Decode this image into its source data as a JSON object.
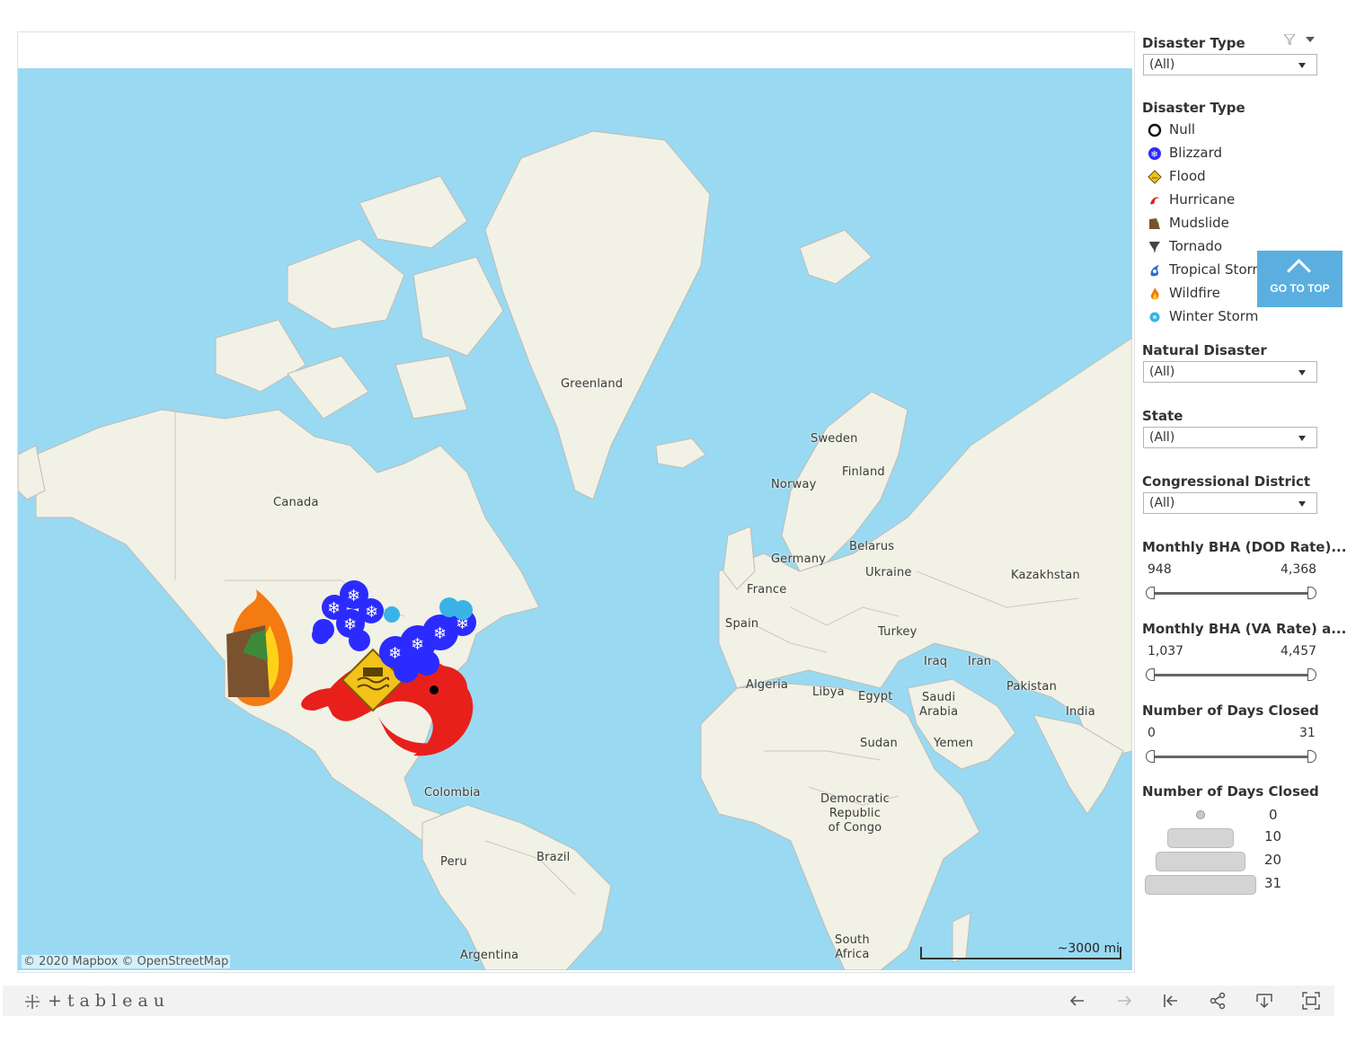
{
  "map": {
    "attribution": "© 2020 Mapbox © OpenStreetMap",
    "scale_label": "~3000 mi",
    "colors": {
      "water": "#9ad9f2",
      "land": "#f1f1e6",
      "border": "#bdbdb4"
    },
    "places": [
      {
        "name": "Greenland"
      },
      {
        "name": "Canada"
      },
      {
        "name": "Sweden"
      },
      {
        "name": "Finland"
      },
      {
        "name": "Norway"
      },
      {
        "name": "Belarus"
      },
      {
        "name": "Germany"
      },
      {
        "name": "Ukraine"
      },
      {
        "name": "Kazakhstan"
      },
      {
        "name": "France"
      },
      {
        "name": "Spain"
      },
      {
        "name": "Turkey"
      },
      {
        "name": "Iraq"
      },
      {
        "name": "Iran"
      },
      {
        "name": "Algeria"
      },
      {
        "name": "Libya"
      },
      {
        "name": "Egypt"
      },
      {
        "name": "Saudi\nArabia"
      },
      {
        "name": "Pakistan"
      },
      {
        "name": "India"
      },
      {
        "name": "Sudan"
      },
      {
        "name": "Yemen"
      },
      {
        "name": "Colombia"
      },
      {
        "name": "Democratic\nRepublic\nof Congo"
      },
      {
        "name": "Brazil"
      },
      {
        "name": "Peru"
      },
      {
        "name": "Argentina"
      },
      {
        "name": "South\nAfrica"
      }
    ]
  },
  "sidebar": {
    "filter_disaster_type": {
      "title": "Disaster Type",
      "value": "(All)"
    },
    "legend": {
      "title": "Disaster Type",
      "items": [
        {
          "label": "Null",
          "icon": "null-icon",
          "color": "#111111"
        },
        {
          "label": "Blizzard",
          "icon": "blizzard-icon",
          "color": "#2b2bff"
        },
        {
          "label": "Flood",
          "icon": "flood-icon",
          "color": "#f2c21b"
        },
        {
          "label": "Hurricane",
          "icon": "hurricane-icon",
          "color": "#e02020"
        },
        {
          "label": "Mudslide",
          "icon": "mudslide-icon",
          "color": "#7a5230"
        },
        {
          "label": "Tornado",
          "icon": "tornado-icon",
          "color": "#444444"
        },
        {
          "label": "Tropical Storm",
          "icon": "tropical-storm-icon",
          "color": "#2a6fd1"
        },
        {
          "label": "Wildfire",
          "icon": "wildfire-icon",
          "color": "#f47a12"
        },
        {
          "label": "Winter Storm",
          "icon": "winter-storm-icon",
          "color": "#39b3e6"
        }
      ]
    },
    "filter_natural_disaster": {
      "title": "Natural Disaster",
      "value": "(All)"
    },
    "filter_state": {
      "title": "State",
      "value": "(All)"
    },
    "filter_district": {
      "title": "Congressional District",
      "value": "(All)"
    },
    "slider_dod": {
      "title": "Monthly BHA (DOD Rate)...",
      "min": "948",
      "max": "4,368"
    },
    "slider_va": {
      "title": "Monthly BHA (VA Rate) a...",
      "min": "1,037",
      "max": "4,457"
    },
    "slider_days": {
      "title": "Number of Days Closed",
      "min": "0",
      "max": "31"
    },
    "size_legend": {
      "title": "Number of Days Closed",
      "items": [
        {
          "label": "0"
        },
        {
          "label": "10"
        },
        {
          "label": "20"
        },
        {
          "label": "31"
        }
      ]
    }
  },
  "goto_top": {
    "label": "GO TO TOP"
  },
  "footer": {
    "brand": "+tableau"
  }
}
